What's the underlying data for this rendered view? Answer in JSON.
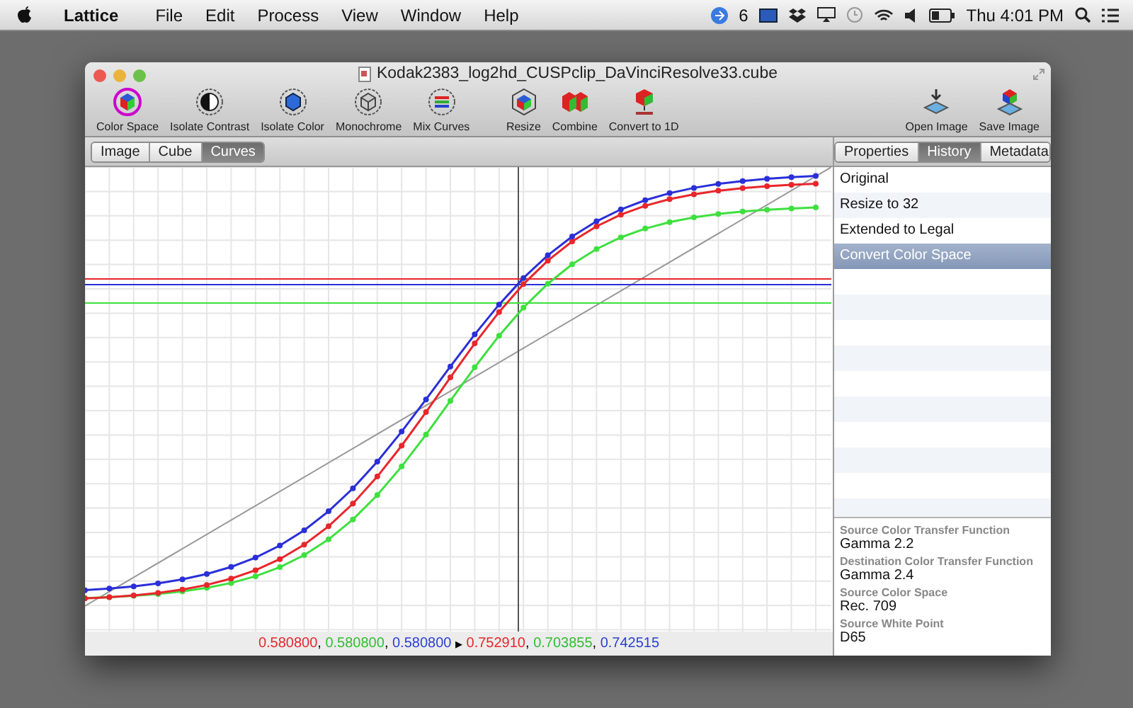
{
  "menu_bar": {
    "app_name": "Lattice",
    "items": [
      "File",
      "Edit",
      "Process",
      "View",
      "Window",
      "Help"
    ],
    "notification_count": "6",
    "clock": "Thu 4:01 PM"
  },
  "window": {
    "title": "Kodak2383_log2hd_CUSPclip_DaVinciResolve33.cube"
  },
  "toolbar": {
    "left": [
      "Color Space",
      "Isolate Contrast",
      "Isolate Color",
      "Monochrome",
      "Mix Curves"
    ],
    "center": [
      "Resize",
      "Combine",
      "Convert to 1D"
    ],
    "right": [
      "Open Image",
      "Save Image"
    ]
  },
  "view_tabs": [
    {
      "label": "Image",
      "selected": false
    },
    {
      "label": "Cube",
      "selected": false
    },
    {
      "label": "Curves",
      "selected": true
    }
  ],
  "panel_tabs": [
    {
      "label": "Properties",
      "selected": false
    },
    {
      "label": "History",
      "selected": true
    },
    {
      "label": "Metadata",
      "selected": false
    }
  ],
  "history": [
    {
      "label": "Original",
      "selected": false
    },
    {
      "label": "Resize to 32",
      "selected": false
    },
    {
      "label": "Extended to Legal",
      "selected": false
    },
    {
      "label": "Convert Color Space",
      "selected": true
    }
  ],
  "properties": [
    {
      "label": "Source Color Transfer Function",
      "value": "Gamma 2.2"
    },
    {
      "label": "Destination Color Transfer Function",
      "value": "Gamma 2.4"
    },
    {
      "label": "Source Color Space",
      "value": "Rec. 709"
    },
    {
      "label": "Source White Point",
      "value": "D65"
    }
  ],
  "readout": {
    "input": [
      {
        "value": "0.580800",
        "color": "#e8262b"
      },
      {
        "value": "0.580800",
        "color": "#2fbf2f"
      },
      {
        "value": "0.580800",
        "color": "#2a3fd6"
      }
    ],
    "separator": ",",
    "arrow": "▸",
    "output": [
      {
        "value": "0.752910",
        "color": "#e8262b"
      },
      {
        "value": "0.703855",
        "color": "#2fbf2f"
      },
      {
        "value": "0.742515",
        "color": "#2a3fd6"
      }
    ]
  }
}
